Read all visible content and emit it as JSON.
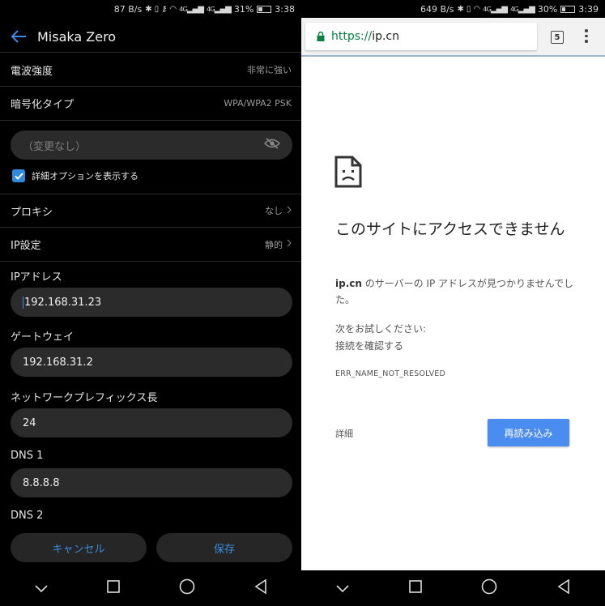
{
  "left": {
    "status_bar": {
      "net_speed": "87 B/s",
      "signal_label_1": "4G",
      "signal_label_2": "4G",
      "battery": "31%",
      "time": "3:38",
      "battery_level": 0.31
    },
    "header": {
      "title": "Misaka Zero",
      "back_icon": "back-arrow-icon"
    },
    "rows": {
      "signal": {
        "label": "電波強度",
        "value": "非常に強い"
      },
      "security": {
        "label": "暗号化タイプ",
        "value": "WPA/WPA2 PSK"
      }
    },
    "password": {
      "placeholder": "（変更なし）",
      "icon": "eye-off-icon"
    },
    "advanced": {
      "label": "詳細オプションを表示する",
      "checked": true
    },
    "proxy": {
      "label": "プロキシ",
      "value": "なし"
    },
    "ip_settings": {
      "label": "IP設定",
      "value": "静的"
    },
    "ip_address": {
      "label": "IPアドレス",
      "value": "192.168.31.23"
    },
    "gateway": {
      "label": "ゲートウェイ",
      "value": "192.168.31.2"
    },
    "prefix": {
      "label": "ネットワークプレフィックス長",
      "value": "24"
    },
    "dns1": {
      "label": "DNS 1",
      "value": "8.8.8.8"
    },
    "dns2": {
      "label": "DNS 2"
    },
    "buttons": {
      "cancel": "キャンセル",
      "save": "保存"
    },
    "colors": {
      "accent": "#3c8be0",
      "field_bg": "#2b2b2b"
    }
  },
  "right": {
    "status_bar": {
      "net_speed": "649 B/s",
      "signal_label_1": "4G",
      "signal_label_2": "4G",
      "battery": "30%",
      "time": "3:39",
      "battery_level": 0.3
    },
    "browser": {
      "url_scheme": "https://",
      "url_host": "ip.cn",
      "tab_count": "5"
    },
    "error": {
      "title": "このサイトにアクセスできません",
      "host": "ip.cn",
      "desc": " のサーバーの IP アドレスが見つかりませんでした。",
      "try_heading": "次をお試しください:",
      "try_item": "接続を確認する",
      "code": "ERR_NAME_NOT_RESOLVED",
      "details": "詳細",
      "reload": "再読み込み"
    },
    "colors": {
      "reload_button": "#4b8cf0",
      "secure_green": "#0b8043"
    }
  },
  "nav_icons": [
    "chevron-down-icon",
    "square-icon",
    "circle-icon",
    "triangle-back-icon"
  ]
}
